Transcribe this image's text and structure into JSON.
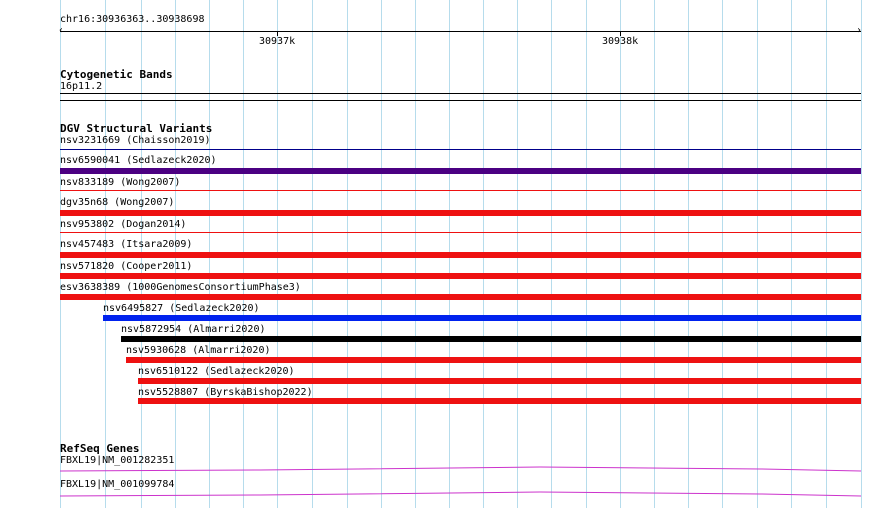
{
  "ruler": {
    "range_label": "chr16:30936363..30938698",
    "ticks": [
      "30937k",
      "30938k"
    ]
  },
  "cytoband": {
    "title": "Cytogenetic Bands",
    "band_label": "16p11.2"
  },
  "dgv": {
    "title": "DGV Structural Variants",
    "features": [
      {
        "label": "nsv3231669 (Chaisson2019)",
        "color": "#00008b"
      },
      {
        "label": "nsv6590041 (Sedlazeck2020)",
        "color": "#4b0082"
      },
      {
        "label": "nsv833189 (Wong2007)",
        "color": "#ee1111"
      },
      {
        "label": "dgv35n68 (Wong2007)",
        "color": "#ee1111"
      },
      {
        "label": "nsv953802 (Dogan2014)",
        "color": "#ee1111"
      },
      {
        "label": "nsv457483 (Itsara2009)",
        "color": "#ee1111"
      },
      {
        "label": "nsv571820 (Cooper2011)",
        "color": "#ee1111"
      },
      {
        "label": "esv3638389 (1000GenomesConsortiumPhase3)",
        "color": "#ee1111"
      },
      {
        "label": "nsv6495827 (Sedlazeck2020)",
        "color": "#0022ee"
      },
      {
        "label": "nsv5872954 (Almarri2020)",
        "color": "#000000"
      },
      {
        "label": "nsv5930628 (Almarri2020)",
        "color": "#ee1111"
      },
      {
        "label": "nsv6510122 (Sedlazeck2020)",
        "color": "#ee1111"
      },
      {
        "label": "nsv5528807 (ByrskaBishop2022)",
        "color": "#ee1111"
      }
    ]
  },
  "refseq": {
    "title": "RefSeq Genes",
    "genes": [
      {
        "label": "FBXL19|NM_001282351",
        "color": "#cc33cc"
      },
      {
        "label": "FBXL19|NM_001099784",
        "color": "#cc33cc"
      }
    ]
  }
}
